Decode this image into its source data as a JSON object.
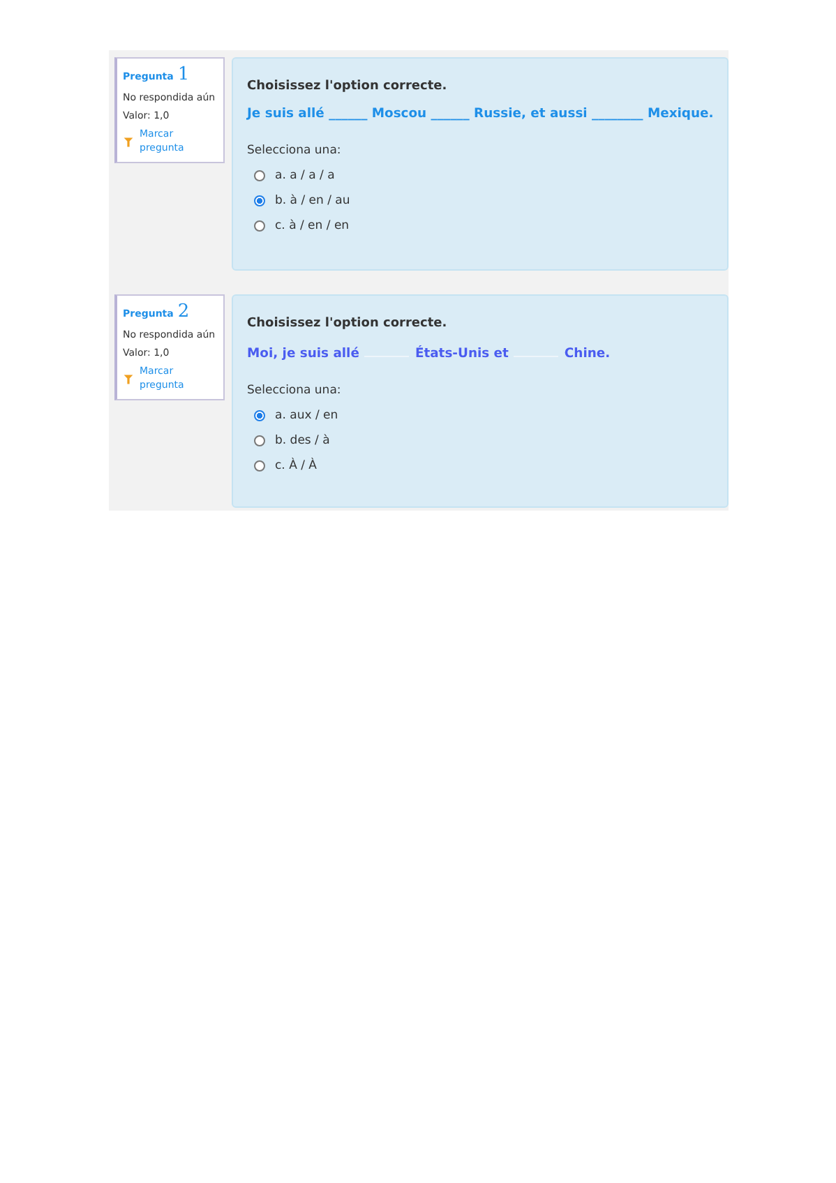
{
  "questions": [
    {
      "label": "Pregunta",
      "number": "1",
      "status": "No respondida aún",
      "value": "Valor: 1,0",
      "flag": "Marcar pregunta",
      "prompt": "Choisissez l'option correcte.",
      "color": "#1e8fe8",
      "sentence": [
        {
          "kind": "text",
          "text": "Je suis allé ______ Moscou ______ Russie, et aussi ________ Mexique."
        }
      ],
      "instruction": "Selecciona una:",
      "options": [
        {
          "text": "a. a / a / a",
          "selected": false
        },
        {
          "text": "b. à / en / au",
          "selected": true
        },
        {
          "text": "c. à / en / en",
          "selected": false
        }
      ]
    },
    {
      "label": "Pregunta",
      "number": "2",
      "status": "No respondida aún",
      "value": "Valor: 1,0",
      "flag": "Marcar pregunta",
      "prompt": "Choisissez l'option correcte.",
      "color": "#4a5cf0",
      "sentence": [
        {
          "kind": "text",
          "text": "Moi, je suis allé"
        },
        {
          "kind": "gap"
        },
        {
          "kind": "text",
          "text": "États-Unis et"
        },
        {
          "kind": "gap"
        },
        {
          "kind": "text",
          "text": "Chine."
        }
      ],
      "instruction": "Selecciona una:",
      "options": [
        {
          "text": "a. aux / en",
          "selected": true
        },
        {
          "text": "b. des / à",
          "selected": false
        },
        {
          "text": "c. À / À",
          "selected": false
        }
      ]
    }
  ]
}
